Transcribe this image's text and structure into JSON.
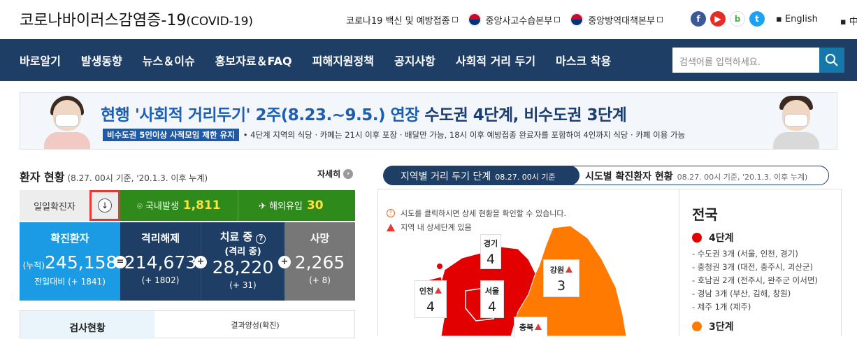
{
  "header": {
    "logo_main": "코로나바이러스감염증-19",
    "logo_sub": "(COVID-19)",
    "links": [
      "코로나19 백신 및 예방접종",
      "중앙사고수습본부",
      "중앙방역대책본부"
    ],
    "langs": [
      "English",
      "中文"
    ]
  },
  "nav": {
    "items": [
      "바로알기",
      "발생동향",
      "뉴스＆이슈",
      "홍보자료＆FAQ",
      "피해지원정책",
      "공지사항",
      "사회적 거리 두기",
      "마스크 착용"
    ],
    "search_placeholder": "검색어를 입력하세요."
  },
  "banner": {
    "title_a": "현행 '사회적 거리두기' 2주(8.23.~9.5.) 연장 ",
    "title_b": "수도권 4단계, 비수도권 3단계",
    "tag": "비수도권 5인이상 사적모임 제한 유지",
    "desc": "• 4단계 지역의 식당 · 카페는 21시 이후 포장 · 배달만 가능, 18시 이후 예방접종 완료자를 포함하여 4인까지 식당 · 카페 이용 가능"
  },
  "status": {
    "title": "환자 현황",
    "note": "(8.27. 00시 기준, '20.1.3. 이후 누계)",
    "more": "자세히",
    "daily_label": "일일확진자",
    "domestic_label": "국내발생",
    "domestic_value": "1,811",
    "overseas_label": "해외유입",
    "overseas_value": "30"
  },
  "stats": [
    {
      "label": "확진환자",
      "prefix": "(누적)",
      "value": "245,158",
      "change": "전일대비 (+ 1841)"
    },
    {
      "label": "격리해제",
      "value": "214,673",
      "change": "(+ 1802)"
    },
    {
      "label": "치료 중",
      "label2": "(격리 중)",
      "value": "28,220",
      "change": "(+ 31)"
    },
    {
      "label": "사망",
      "value": "2,265",
      "change": "(+ 8)"
    }
  ],
  "test": {
    "label": "검사현황",
    "right_label": "결과양성(확진)"
  },
  "tabs": {
    "tab1": "지역별 거리 두기 단계",
    "tab1_note": "08.27. 00시 기준",
    "tab2": "시도별 확진환자 현황",
    "tab2_note": "08.27. 00시 기준, '20.1.3. 이후 누계)"
  },
  "map": {
    "info1": "시도를 클릭하시면 상세 현황을 확인할 수 있습니다.",
    "info2": "지역 내 상세단계 있음",
    "regions": [
      {
        "name": "경기",
        "level": "4"
      },
      {
        "name": "강원",
        "level": "3"
      },
      {
        "name": "인천",
        "level": "4"
      },
      {
        "name": "서울",
        "level": "4"
      },
      {
        "name": "충북",
        "level": ""
      }
    ],
    "colors": {
      "level4": "#e30000",
      "level3": "#ff7a00"
    }
  },
  "side": {
    "title": "전국",
    "level4": "4단계",
    "level4_items": [
      "- 수도권 3개 (서울, 인천, 경기)",
      "- 충청권 3개 (대전, 충주시, 괴산군)",
      "- 호남권 2개 (전주시, 완주군 이서면)",
      "- 경남 3개 (부산, 김해, 창원)",
      "- 제주 1개 (제주)"
    ],
    "level3": "3단계"
  }
}
